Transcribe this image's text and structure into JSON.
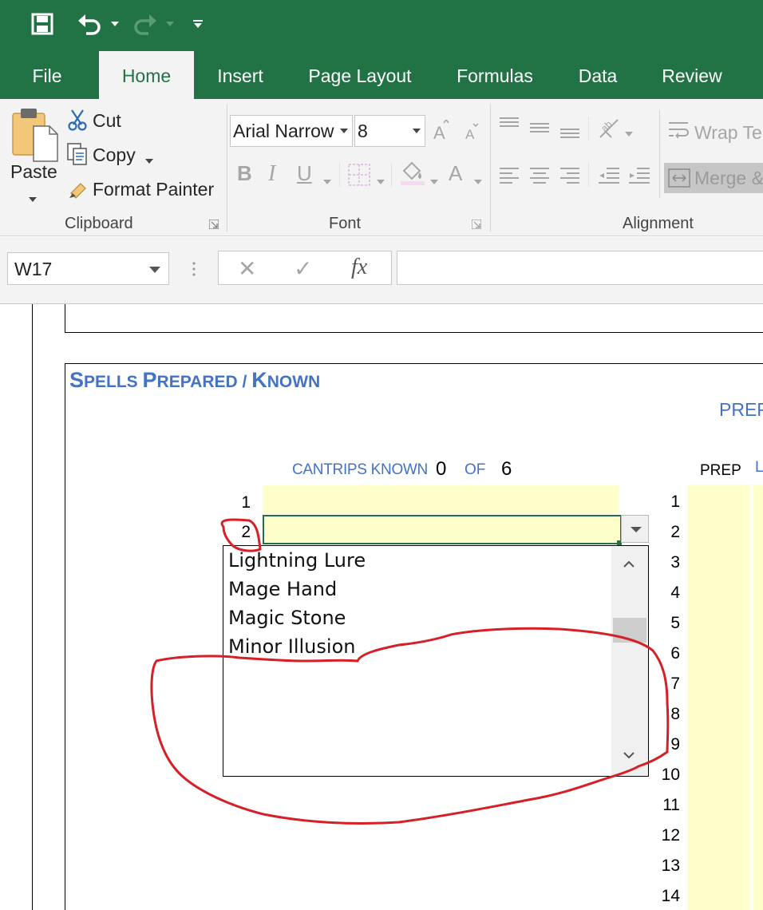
{
  "quick_access": {
    "save": "save-icon",
    "undo": "undo-icon",
    "redo": "redo-icon",
    "customize": "customize-icon"
  },
  "tabs": [
    {
      "label": "File"
    },
    {
      "label": "Home",
      "active": true
    },
    {
      "label": "Insert"
    },
    {
      "label": "Page Layout"
    },
    {
      "label": "Formulas"
    },
    {
      "label": "Data"
    },
    {
      "label": "Review"
    }
  ],
  "ribbon": {
    "clipboard": {
      "paste": "Paste",
      "cut": "Cut",
      "copy": "Copy",
      "format_painter": "Format Painter",
      "group_label": "Clipboard"
    },
    "font": {
      "font_name": "Arial Narrow",
      "font_size": "8",
      "bold": "B",
      "italic": "I",
      "underline": "U",
      "font_color": "A",
      "group_label": "Font"
    },
    "alignment": {
      "wrap_text": "Wrap Te",
      "merge": "Merge &",
      "group_label": "Alignment"
    }
  },
  "formula_bar": {
    "name_box": "W17",
    "cancel": "✕",
    "enter": "✓",
    "fx": "fx",
    "value": ""
  },
  "sheet": {
    "section_title": {
      "big1": "S",
      "small1": "PELLS ",
      "big2": "P",
      "small2": "REPARED / ",
      "big3": "K",
      "small3": "NOWN"
    },
    "prep_header": "PREP",
    "cantrips_label": "CANTRIPS KNOWN",
    "cantrips_count": "0",
    "of_label": "OF",
    "cantrips_max": "6",
    "prep_col_label": "PREP",
    "right_partial_label": "L",
    "left_rows": [
      "1",
      "2"
    ],
    "right_rows": [
      "1",
      "2",
      "3",
      "4",
      "5",
      "6",
      "7",
      "8",
      "9",
      "10",
      "11",
      "12",
      "13",
      "14"
    ]
  },
  "dropdown": {
    "items": [
      "Lightning Lure",
      "Mage Hand",
      "Magic Stone",
      "Minor Illusion"
    ],
    "scroll_position": 0.28
  },
  "colors": {
    "excel_green": "#217346",
    "cell_yellow": "#ffffcc",
    "title_blue": "#4472c4",
    "annotation_red": "#d61f26"
  }
}
